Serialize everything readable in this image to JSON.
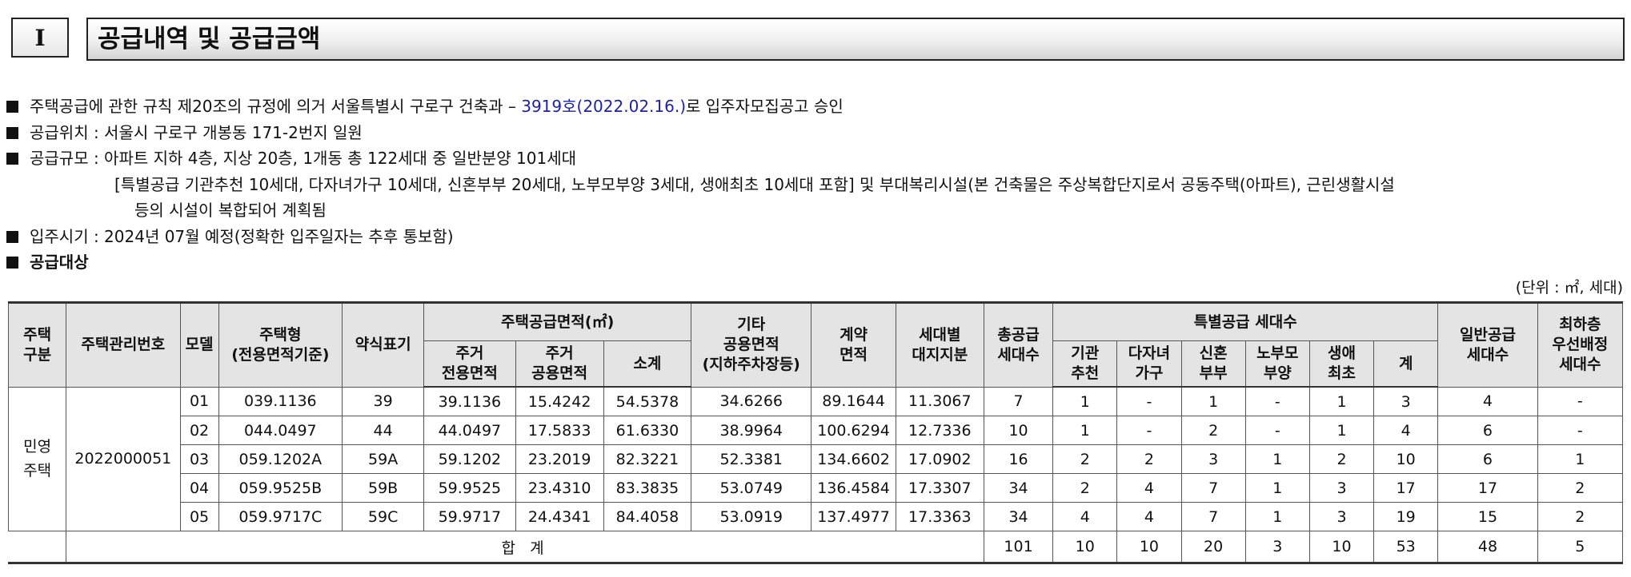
{
  "section": {
    "number": "I",
    "title": "공급내역 및 공급금액"
  },
  "info": {
    "line1_a": "주택공급에 관한 규칙 제20조의 규정에 의거 서울특별시 구로구 건축과 – ",
    "line1_approval": "3919호(2022.02.16.)",
    "line1_b": "로 입주자모집공고 승인",
    "line2": "공급위치 : 서울시 구로구 개봉동 171-2번지 일원",
    "line3": "공급규모 : 아파트 지하 4층, 지상 20층, 1개동 총 122세대 중 일반분양 101세대",
    "line3_cont": "[특별공급 기관추천 10세대, 다자녀가구 10세대, 신혼부부 20세대, 노부모부양 3세대, 생애최초 10세대 포함] 및 부대복리시설(본 건축물은 주상복합단지로서 공동주택(아파트), 근린생활시설",
    "line3_cont2": "등의 시설이 복합되어 계획됨",
    "line4": "입주시기 : 2024년 07월 예정(정확한 입주일자는 추후 통보함)",
    "line5": "공급대상"
  },
  "unit_note": "(단위 : ㎡, 세대)",
  "table": {
    "headers": {
      "housing_type_division": "주택\n구분",
      "mgmt_no": "주택관리번호",
      "model": "모델",
      "housing_type": "주택형\n(전용면적기준)",
      "abbr": "약식표기",
      "supply_area": "주택공급면적(㎡)",
      "res_excl": "주거\n전용면적",
      "res_common": "주거\n공용면적",
      "subtotal": "소계",
      "other_common": "기타\n공용면적\n(지하주차장등)",
      "contract_area": "계약\n면적",
      "land_share": "세대별\n대지지분",
      "total_supply": "총공급\n세대수",
      "special_supply": "특별공급 세대수",
      "sp_inst": "기관\n추천",
      "sp_multi": "다자녀\n가구",
      "sp_newly": "신혼\n부부",
      "sp_parents": "노부모\n부양",
      "sp_first": "생애\n최초",
      "sp_sum": "계",
      "general_supply": "일반공급\n세대수",
      "lowest_floor": "최하층\n우선배정\n세대수"
    },
    "division_label": "민영\n주택",
    "mgmt_no_value": "2022000051",
    "rows": [
      {
        "model": "01",
        "type": "039.1136",
        "abbr": "39",
        "excl": "39.1136",
        "common": "15.4242",
        "subtotal": "54.5378",
        "other": "34.6266",
        "contract": "89.1644",
        "land": "11.3067",
        "total": "7",
        "inst": "1",
        "multi": "-",
        "newly": "1",
        "parents": "-",
        "first": "1",
        "sp_sum": "3",
        "general": "4",
        "lowest": "-"
      },
      {
        "model": "02",
        "type": "044.0497",
        "abbr": "44",
        "excl": "44.0497",
        "common": "17.5833",
        "subtotal": "61.6330",
        "other": "38.9964",
        "contract": "100.6294",
        "land": "12.7336",
        "total": "10",
        "inst": "1",
        "multi": "-",
        "newly": "2",
        "parents": "-",
        "first": "1",
        "sp_sum": "4",
        "general": "6",
        "lowest": "-"
      },
      {
        "model": "03",
        "type": "059.1202A",
        "abbr": "59A",
        "excl": "59.1202",
        "common": "23.2019",
        "subtotal": "82.3221",
        "other": "52.3381",
        "contract": "134.6602",
        "land": "17.0902",
        "total": "16",
        "inst": "2",
        "multi": "2",
        "newly": "3",
        "parents": "1",
        "first": "2",
        "sp_sum": "10",
        "general": "6",
        "lowest": "1"
      },
      {
        "model": "04",
        "type": "059.9525B",
        "abbr": "59B",
        "excl": "59.9525",
        "common": "23.4310",
        "subtotal": "83.3835",
        "other": "53.0749",
        "contract": "136.4584",
        "land": "17.3307",
        "total": "34",
        "inst": "2",
        "multi": "4",
        "newly": "7",
        "parents": "1",
        "first": "3",
        "sp_sum": "17",
        "general": "17",
        "lowest": "2"
      },
      {
        "model": "05",
        "type": "059.9717C",
        "abbr": "59C",
        "excl": "59.9717",
        "common": "24.4341",
        "subtotal": "84.4058",
        "other": "53.0919",
        "contract": "137.4977",
        "land": "17.3363",
        "total": "34",
        "inst": "4",
        "multi": "4",
        "newly": "7",
        "parents": "1",
        "first": "3",
        "sp_sum": "19",
        "general": "15",
        "lowest": "2"
      }
    ],
    "totals": {
      "label": "합 계",
      "total": "101",
      "inst": "10",
      "multi": "10",
      "newly": "20",
      "parents": "3",
      "first": "10",
      "sp_sum": "53",
      "general": "48",
      "lowest": "5"
    }
  }
}
